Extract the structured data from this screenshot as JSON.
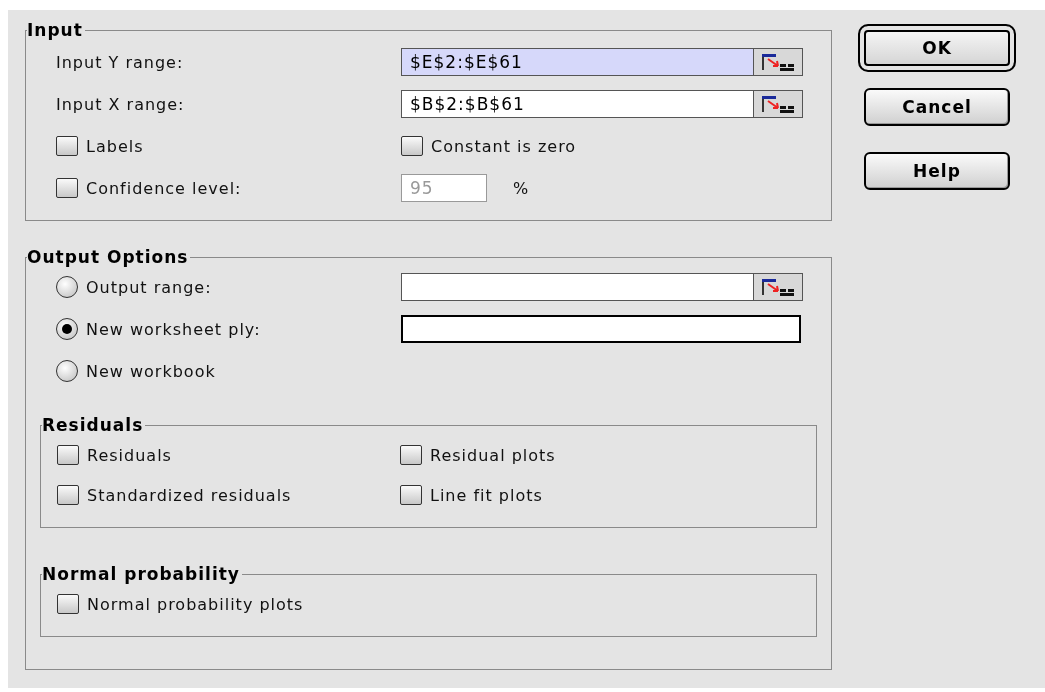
{
  "input": {
    "title": "Input",
    "ranges": [
      {
        "label": "Input Y range:",
        "value": "$E$2:$E$61",
        "selected": true
      },
      {
        "label": "Input X range:",
        "value": "$B$2:$B$61",
        "selected": false
      }
    ],
    "options": [
      {
        "label": "Labels",
        "checked": false
      },
      {
        "label": "Constant is zero",
        "checked": false
      }
    ],
    "confidence": {
      "label": "Confidence level:",
      "checked": false,
      "value": "95",
      "disabled": true,
      "unit": "%"
    }
  },
  "output": {
    "title": "Output Options",
    "choices": [
      {
        "label": "Output range:",
        "selected": false,
        "kind": "range"
      },
      {
        "label": "New worksheet ply:",
        "selected": true,
        "kind": "text"
      },
      {
        "label": "New workbook",
        "selected": false
      }
    ],
    "groups": [
      {
        "title": "Residuals",
        "options": [
          {
            "label": "Residuals",
            "checked": false
          },
          {
            "label": "Residual plots",
            "checked": false
          },
          {
            "label": "Standardized residuals",
            "checked": false
          },
          {
            "label": "Line fit plots",
            "checked": false
          }
        ]
      },
      {
        "title": "Normal probability",
        "options": [
          {
            "label": "Normal probability plots",
            "checked": false
          }
        ]
      }
    ]
  },
  "buttons": [
    {
      "label": "OK",
      "default": true
    },
    {
      "label": "Cancel",
      "default": false
    },
    {
      "label": "Help",
      "default": false
    }
  ]
}
